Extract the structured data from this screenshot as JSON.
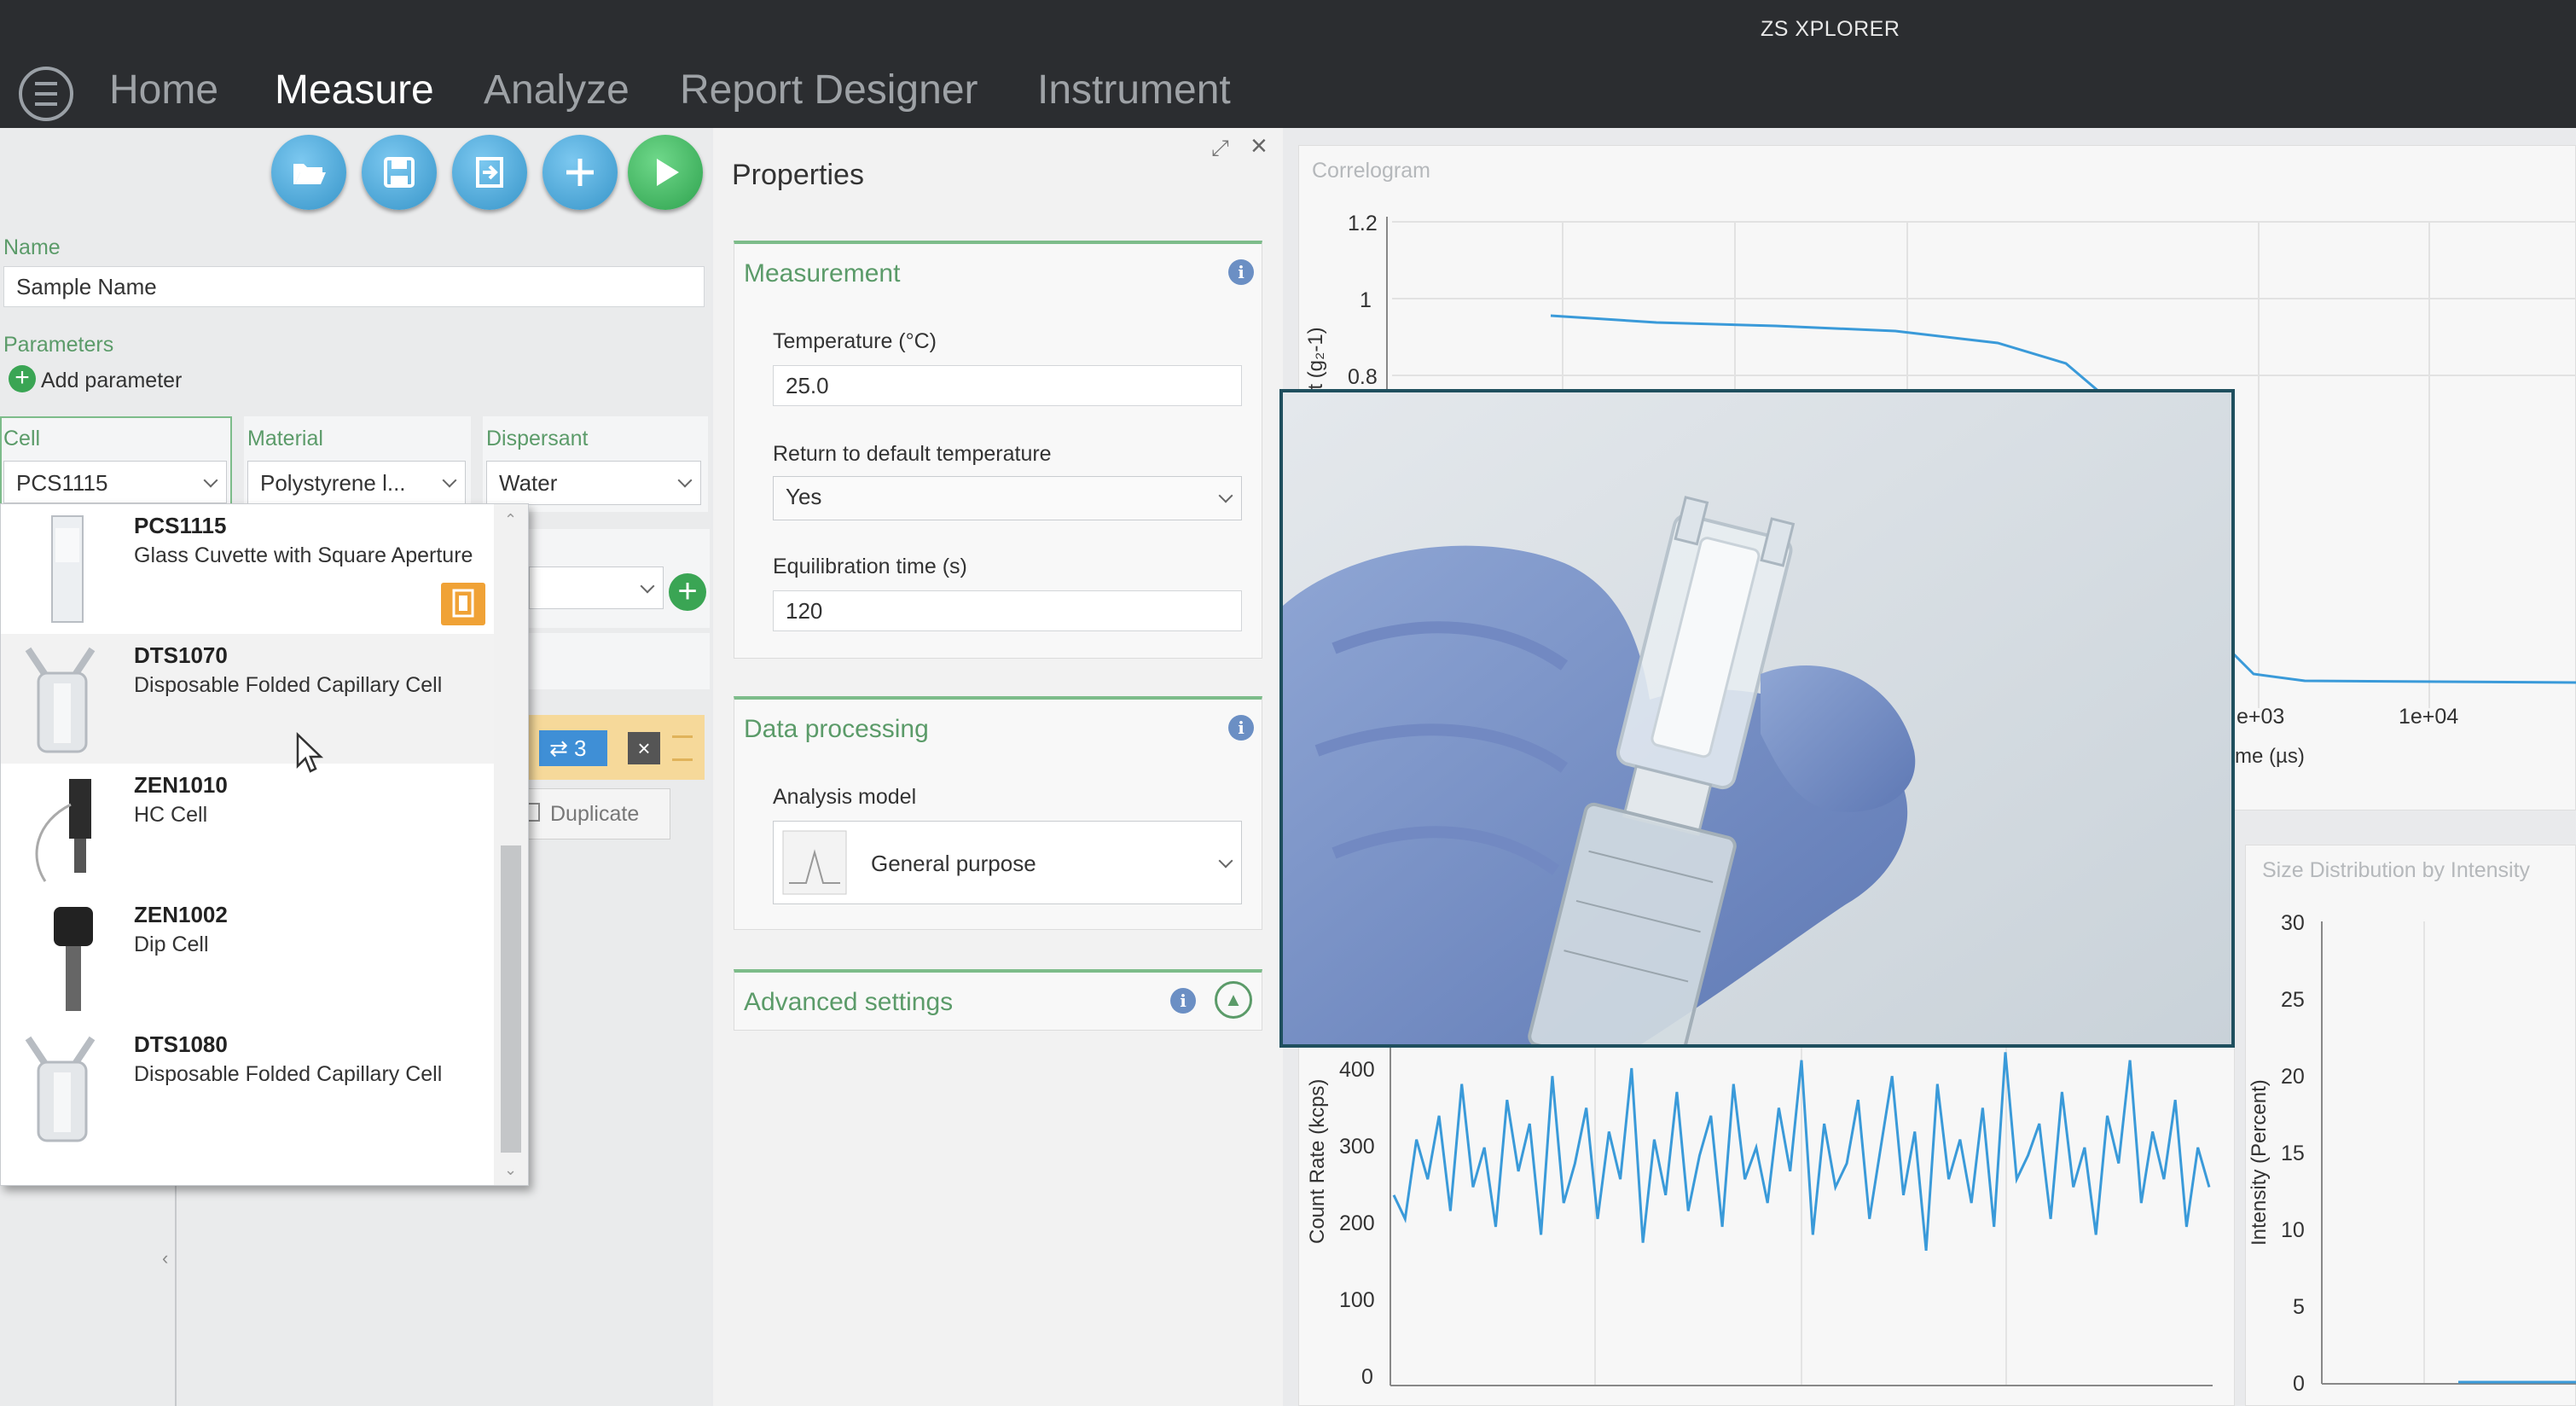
{
  "app": {
    "title": "ZS XPLORER"
  },
  "nav": {
    "tabs": [
      {
        "label": "Home"
      },
      {
        "label": "Measure"
      },
      {
        "label": "Analyze"
      },
      {
        "label": "Report Designer"
      },
      {
        "label": "Instrument"
      }
    ],
    "active": "Measure"
  },
  "toolbar": {
    "buttons": [
      "open-icon",
      "save-icon",
      "export-icon",
      "add-icon",
      "run-icon"
    ]
  },
  "sample": {
    "name_label": "Name",
    "name_value": "Sample Name",
    "parameters_label": "Parameters",
    "add_parameter": "Add parameter",
    "cell_label": "Cell",
    "cell_value": "PCS1115",
    "material_label": "Material",
    "material_value": "Polystyrene l...",
    "dispersant_label": "Dispersant",
    "dispersant_value": "Water",
    "sequence_count": "3",
    "duplicate_label": "Duplicate"
  },
  "cell_dropdown": {
    "items": [
      {
        "code": "PCS1115",
        "desc": "Glass Cuvette with Square Aperture"
      },
      {
        "code": "DTS1070",
        "desc": "Disposable Folded Capillary Cell"
      },
      {
        "code": "ZEN1010",
        "desc": "HC Cell"
      },
      {
        "code": "ZEN1002",
        "desc": "Dip Cell"
      },
      {
        "code": "DTS1080",
        "desc": "Disposable Folded Capillary Cell"
      }
    ]
  },
  "properties": {
    "title": "Properties",
    "measurement": {
      "title": "Measurement",
      "temperature_label": "Temperature (°C)",
      "temperature_value": "25.0",
      "return_label": "Return to default temperature",
      "return_value": "Yes",
      "equilibration_label": "Equilibration time (s)",
      "equilibration_value": "120"
    },
    "data_processing": {
      "title": "Data processing",
      "model_label": "Analysis model",
      "model_value": "General purpose"
    },
    "advanced": {
      "title": "Advanced settings"
    }
  },
  "charts": {
    "correlogram": {
      "title": "Correlogram",
      "ylabel_visible": "nt (g₂-1)",
      "xlabel_visible": "me (µs)",
      "yticks": [
        "1.2",
        "1",
        "0.8"
      ],
      "xticks": [
        "e+03",
        "1e+04"
      ]
    },
    "count_rate": {
      "ylabel": "Count Rate (kcps)",
      "yticks": [
        "400",
        "300",
        "200",
        "100",
        "0"
      ]
    },
    "size_distribution": {
      "title": "Size Distribution by Intensity",
      "ylabel": "Intensity (Percent)",
      "yticks": [
        "30",
        "25",
        "20",
        "15",
        "10",
        "5",
        "0"
      ]
    }
  },
  "colors": {
    "accent_green": "#5b9b69",
    "plot_blue": "#3a9ad9",
    "titlebar": "#2b2d30"
  },
  "chart_data": [
    {
      "type": "line",
      "title": "Correlogram",
      "xlabel": "me (µs)",
      "ylabel": "nt (g₂-1)",
      "xscale": "log",
      "x": [
        30,
        100,
        300,
        700,
        1000,
        2000,
        3000,
        10000,
        30000
      ],
      "y": [
        0.95,
        0.94,
        0.92,
        0.86,
        0.8,
        0.45,
        0.05,
        0.0,
        0.0
      ]
    },
    {
      "type": "line",
      "title": "",
      "ylabel": "Count Rate (kcps)",
      "ylim": [
        0,
        400
      ],
      "y": [
        240,
        210,
        310,
        260,
        340,
        220,
        380,
        250,
        300,
        200,
        360,
        270,
        330,
        190,
        390,
        230,
        280,
        350,
        210,
        320,
        260,
        400,
        180,
        310,
        240,
        370,
        220,
        290,
        340,
        200,
        380,
        260,
        300,
        230,
        350,
        270,
        410,
        190,
        330,
        250,
        280,
        360,
        210,
        300,
        390,
        240,
        320,
        170,
        380,
        260,
        310,
        230,
        350,
        200,
        420,
        260,
        290,
        330,
        210,
        370,
        250,
        300,
        190,
        340,
        280,
        410,
        230,
        320,
        260,
        360,
        200,
        300,
        250
      ]
    }
  ]
}
